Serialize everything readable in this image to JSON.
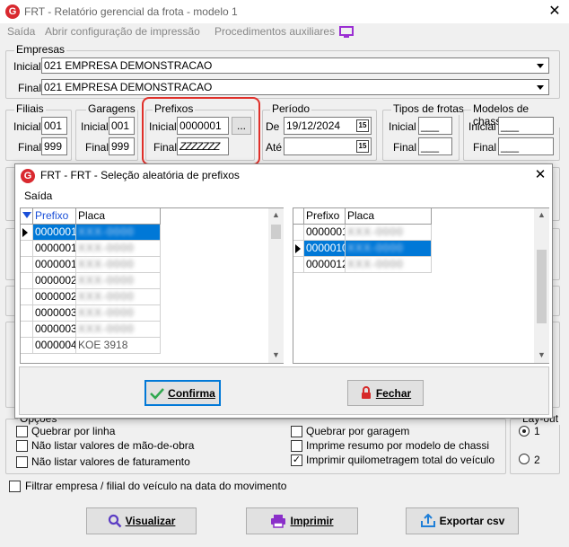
{
  "window": {
    "logo": "G",
    "title": "FRT - Relatório gerencial da frota - modelo 1",
    "close": "X"
  },
  "menu": {
    "items": [
      "Saída",
      "Abrir configuração de impressão",
      "Procedimentos auxiliares"
    ],
    "monitor_icon": "monitor-icon"
  },
  "empresas": {
    "legend": "Empresas",
    "inicial_label": "Inicial",
    "inicial_value": "021 EMPRESA DEMONSTRACAO",
    "final_label": "Final",
    "final_value": "021 EMPRESA DEMONSTRACAO"
  },
  "filiais": {
    "legend": "Filiais",
    "inicial_label": "Inicial",
    "inicial_value": "001",
    "final_label": "Final",
    "final_value": "999"
  },
  "garagens": {
    "legend": "Garagens",
    "inicial_label": "Inicial",
    "inicial_value": "001",
    "final_label": "Final",
    "final_value": "999"
  },
  "prefixos": {
    "legend": "Prefixos",
    "inicial_label": "Inicial",
    "inicial_value": "0000001",
    "final_label": "Final",
    "final_value": "ZZZZZZZ",
    "dots_label": "..."
  },
  "periodo": {
    "legend": "Período",
    "de_label": "De",
    "de_value": "19/12/2024",
    "ate_label": "Até",
    "ate_value": " /  /",
    "cal_label": "15"
  },
  "tipos": {
    "legend": "Tipos de frotas",
    "inicial_label": "Inicial",
    "inicial_value": "___",
    "final_label": "Final",
    "final_value": "___"
  },
  "modelos": {
    "legend": "Modelos de chassis",
    "inicial_label": "Inicial",
    "inicial_value": "___",
    "final_label": "Final",
    "final_value": "___"
  },
  "modal": {
    "logo": "G",
    "title": "FRT - FRT - Seleção aleatória de prefixos",
    "close": "X",
    "menu_saida": "Saída",
    "left_grid": {
      "headers": [
        "Prefixo",
        "Placa"
      ],
      "rows": [
        {
          "prefixo": "0000001",
          "placa": "XXX-0000",
          "selected": true
        },
        {
          "prefixo": "0000001",
          "placa": "XXX-0000",
          "selected": false
        },
        {
          "prefixo": "0000001",
          "placa": "XXX-0000",
          "selected": false
        },
        {
          "prefixo": "0000002",
          "placa": "XXX-0000",
          "selected": false
        },
        {
          "prefixo": "0000002",
          "placa": "XXX-0000",
          "selected": false
        },
        {
          "prefixo": "0000003",
          "placa": "XXX-0000",
          "selected": false
        },
        {
          "prefixo": "0000003",
          "placa": "XXX-0000",
          "selected": false
        },
        {
          "prefixo": "0000004",
          "placa": "KOE 3918",
          "selected": false
        }
      ]
    },
    "right_grid": {
      "headers": [
        "Prefixo",
        "Placa"
      ],
      "rows": [
        {
          "prefixo": "0000001",
          "placa": "XXX-0000",
          "selected": false
        },
        {
          "prefixo": "0000010",
          "placa": "XXX-0000",
          "selected": true
        },
        {
          "prefixo": "0000012",
          "placa": "XXX-0000",
          "selected": false
        }
      ]
    },
    "confirma_label": "Confirma",
    "fechar_label": "Fechar"
  },
  "opcoes": {
    "legend": "Opções",
    "items": [
      {
        "label": "Quebrar por linha",
        "checked": false
      },
      {
        "label": "Não listar valores de mão-de-obra",
        "checked": false
      },
      {
        "label": "Não listar valores de faturamento",
        "checked": false
      },
      {
        "label": "Quebrar por garagem",
        "checked": false
      },
      {
        "label": "Imprime resumo por modelo de chassi",
        "checked": false
      },
      {
        "label": "Imprimir quilometragem total do veículo",
        "checked": true
      }
    ]
  },
  "layout_group": {
    "legend": "Lay-out",
    "opt1": "1",
    "opt2": "2"
  },
  "filtrar_label": "Filtrar empresa / filial do veículo na data do movimento",
  "buttons": {
    "visualizar": "Visualizar",
    "imprimir": "Imprimir",
    "exportar": "Exportar csv"
  },
  "colors": {
    "selection": "#0078d7",
    "highlight_ring": "#e0302a"
  }
}
